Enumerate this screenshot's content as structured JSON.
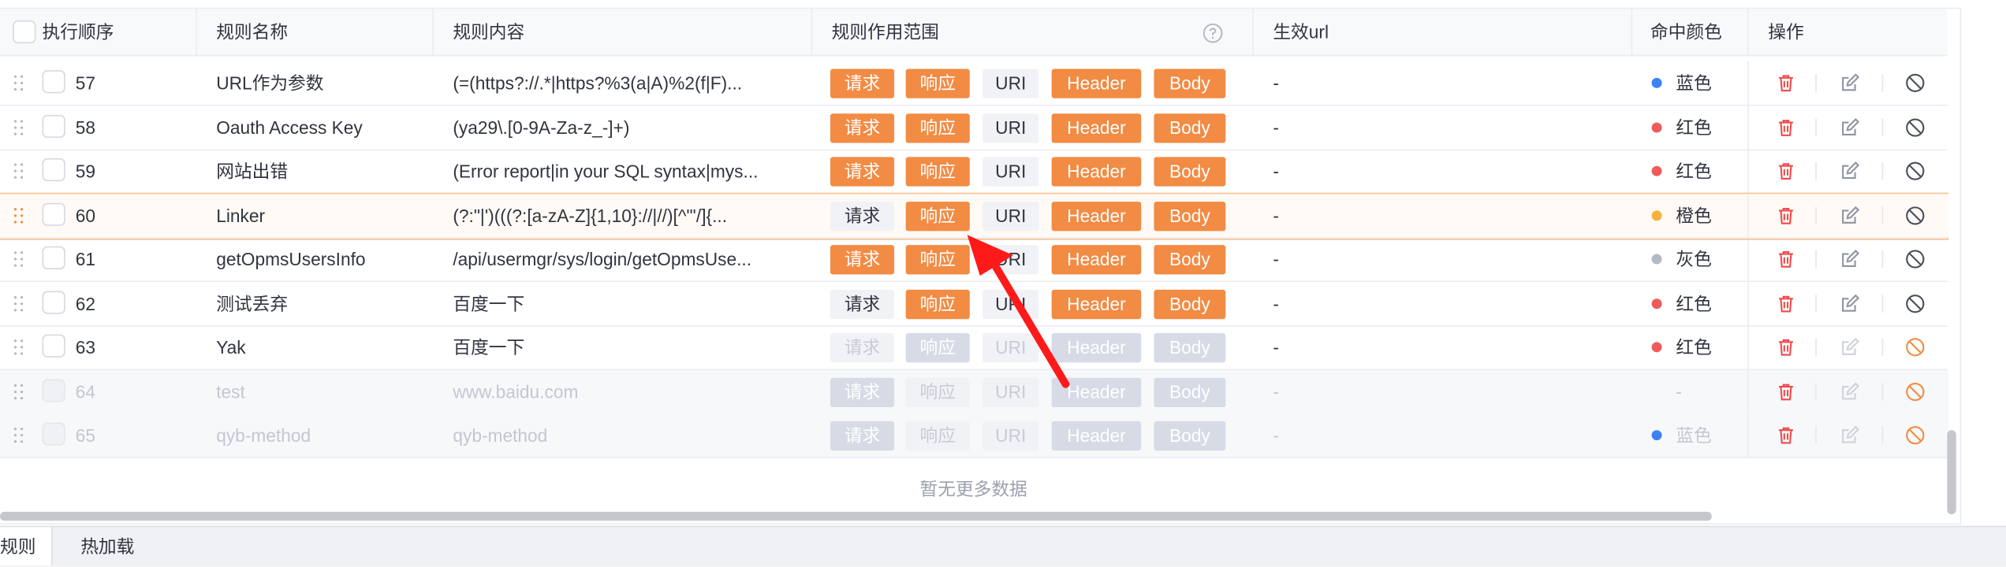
{
  "header": {
    "order": "执行顺序",
    "name": "规则名称",
    "content": "规则内容",
    "scope": "规则作用范围",
    "url": "生效url",
    "color": "命中颜色",
    "ops": "操作"
  },
  "tag_labels": [
    "请求",
    "响应",
    "URI",
    "Header",
    "Body"
  ],
  "rows": [
    {
      "order": "57",
      "name": "URL作为参数",
      "content": "(=(https?://.*|https?%3(a|A)%2(f|F)...",
      "url": "-",
      "color_label": "蓝色",
      "color_hex": "#3b82f6",
      "state": "normal",
      "tags_on": [
        true,
        true,
        false,
        true,
        true
      ]
    },
    {
      "order": "58",
      "name": "Oauth Access Key",
      "content": "(ya29\\.[0-9A-Za-z_-]+)",
      "url": "-",
      "color_label": "红色",
      "color_hex": "#ef5b5b",
      "state": "normal",
      "tags_on": [
        true,
        true,
        false,
        true,
        true
      ]
    },
    {
      "order": "59",
      "name": "网站出错",
      "content": "(Error report|in your SQL syntax|mys...",
      "url": "-",
      "color_label": "红色",
      "color_hex": "#ef5b5b",
      "state": "normal",
      "tags_on": [
        true,
        true,
        false,
        true,
        true
      ]
    },
    {
      "order": "60",
      "name": "Linker",
      "content": "(?:\"|')(((?:[a-zA-Z]{1,10}://|//)[^\"'/]{...",
      "url": "-",
      "color_label": "橙色",
      "color_hex": "#f6b13f",
      "state": "highlight",
      "tags_on": [
        false,
        true,
        false,
        true,
        true
      ]
    },
    {
      "order": "61",
      "name": "getOpmsUsersInfo",
      "content": "/api/usermgr/sys/login/getOpmsUse...",
      "url": "-",
      "color_label": "灰色",
      "color_hex": "#b4b9c6",
      "state": "normal",
      "tags_on": [
        true,
        true,
        false,
        true,
        true
      ]
    },
    {
      "order": "62",
      "name": "测试丢弃",
      "content": "百度一下",
      "url": "-",
      "color_label": "红色",
      "color_hex": "#ef5b5b",
      "state": "normal",
      "tags_on": [
        false,
        true,
        false,
        true,
        true
      ]
    },
    {
      "order": "63",
      "name": "Yak",
      "content": "百度一下",
      "url": "-",
      "color_label": "红色",
      "color_hex": "#ef5b5b",
      "state": "halfdisabled",
      "tags_on": [
        false,
        true,
        false,
        true,
        true
      ]
    },
    {
      "order": "64",
      "name": "test",
      "content": "www.baidu.com",
      "url": "-",
      "color_label": "-",
      "color_hex": "",
      "state": "disabled",
      "tags_on": [
        true,
        false,
        false,
        true,
        true
      ]
    },
    {
      "order": "65",
      "name": "qyb-method",
      "content": "qyb-method",
      "url": "-",
      "color_label": "蓝色",
      "color_hex": "#3b82f6",
      "state": "disabled",
      "tags_on": [
        true,
        false,
        false,
        true,
        true
      ]
    }
  ],
  "footer": {
    "no_more": "暂无更多数据"
  },
  "bottom_tabs": [
    "规则",
    "热加载"
  ],
  "colors": {
    "accent": "#f28b44",
    "annotation_arrow": "#ff1a1a",
    "delete_icon": "#ef4b4b"
  }
}
